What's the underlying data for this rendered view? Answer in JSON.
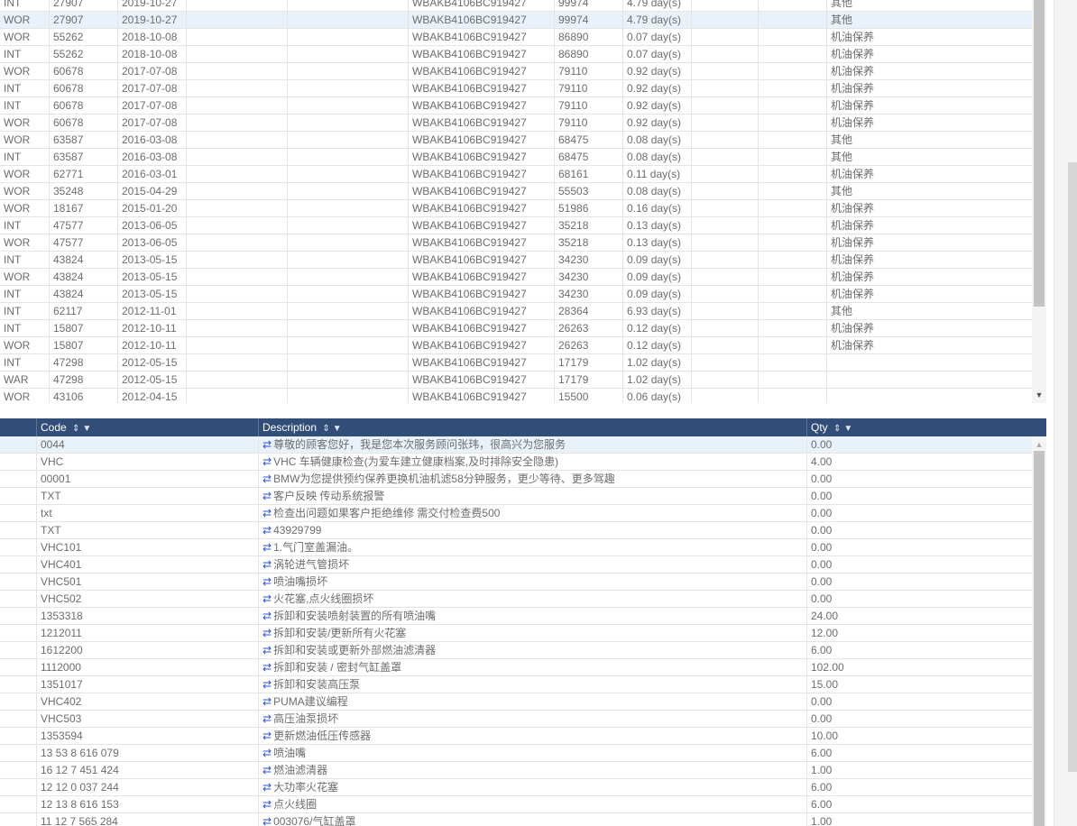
{
  "top_grid": {
    "rows": [
      [
        "INT",
        "27907",
        "2019-10-27",
        "",
        "",
        "WBAKB4106BC919427",
        "99974",
        "4.79 day(s)",
        "",
        "",
        "其他"
      ],
      [
        "WOR",
        "27907",
        "2019-10-27",
        "",
        "",
        "WBAKB4106BC919427",
        "99974",
        "4.79 day(s)",
        "",
        "",
        "其他"
      ],
      [
        "WOR",
        "55262",
        "2018-10-08",
        "",
        "",
        "WBAKB4106BC919427",
        "86890",
        "0.07 day(s)",
        "",
        "",
        "机油保养"
      ],
      [
        "INT",
        "55262",
        "2018-10-08",
        "",
        "",
        "WBAKB4106BC919427",
        "86890",
        "0.07 day(s)",
        "",
        "",
        "机油保养"
      ],
      [
        "WOR",
        "60678",
        "2017-07-08",
        "",
        "",
        "WBAKB4106BC919427",
        "79110",
        "0.92 day(s)",
        "",
        "",
        "机油保养"
      ],
      [
        "INT",
        "60678",
        "2017-07-08",
        "",
        "",
        "WBAKB4106BC919427",
        "79110",
        "0.92 day(s)",
        "",
        "",
        "机油保养"
      ],
      [
        "INT",
        "60678",
        "2017-07-08",
        "",
        "",
        "WBAKB4106BC919427",
        "79110",
        "0.92 day(s)",
        "",
        "",
        "机油保养"
      ],
      [
        "WOR",
        "60678",
        "2017-07-08",
        "",
        "",
        "WBAKB4106BC919427",
        "79110",
        "0.92 day(s)",
        "",
        "",
        "机油保养"
      ],
      [
        "WOR",
        "63587",
        "2016-03-08",
        "",
        "",
        "WBAKB4106BC919427",
        "68475",
        "0.08 day(s)",
        "",
        "",
        "其他"
      ],
      [
        "INT",
        "63587",
        "2016-03-08",
        "",
        "",
        "WBAKB4106BC919427",
        "68475",
        "0.08 day(s)",
        "",
        "",
        "其他"
      ],
      [
        "WOR",
        "62771",
        "2016-03-01",
        "",
        "",
        "WBAKB4106BC919427",
        "68161",
        "0.11 day(s)",
        "",
        "",
        "机油保养"
      ],
      [
        "WOR",
        "35248",
        "2015-04-29",
        "",
        "",
        "WBAKB4106BC919427",
        "55503",
        "0.08 day(s)",
        "",
        "",
        "其他"
      ],
      [
        "WOR",
        "18167",
        "2015-01-20",
        "",
        "",
        "WBAKB4106BC919427",
        "51986",
        "0.16 day(s)",
        "",
        "",
        "机油保养"
      ],
      [
        "INT",
        "47577",
        "2013-06-05",
        "",
        "",
        "WBAKB4106BC919427",
        "35218",
        "0.13 day(s)",
        "",
        "",
        "机油保养"
      ],
      [
        "WOR",
        "47577",
        "2013-06-05",
        "",
        "",
        "WBAKB4106BC919427",
        "35218",
        "0.13 day(s)",
        "",
        "",
        "机油保养"
      ],
      [
        "INT",
        "43824",
        "2013-05-15",
        "",
        "",
        "WBAKB4106BC919427",
        "34230",
        "0.09 day(s)",
        "",
        "",
        "机油保养"
      ],
      [
        "WOR",
        "43824",
        "2013-05-15",
        "",
        "",
        "WBAKB4106BC919427",
        "34230",
        "0.09 day(s)",
        "",
        "",
        "机油保养"
      ],
      [
        "INT",
        "43824",
        "2013-05-15",
        "",
        "",
        "WBAKB4106BC919427",
        "34230",
        "0.09 day(s)",
        "",
        "",
        "机油保养"
      ],
      [
        "INT",
        "62117",
        "2012-11-01",
        "",
        "",
        "WBAKB4106BC919427",
        "28364",
        "6.93 day(s)",
        "",
        "",
        "其他"
      ],
      [
        "INT",
        "15807",
        "2012-10-11",
        "",
        "",
        "WBAKB4106BC919427",
        "26263",
        "0.12 day(s)",
        "",
        "",
        "机油保养"
      ],
      [
        "WOR",
        "15807",
        "2012-10-11",
        "",
        "",
        "WBAKB4106BC919427",
        "26263",
        "0.12 day(s)",
        "",
        "",
        "机油保养"
      ],
      [
        "INT",
        "47298",
        "2012-05-15",
        "",
        "",
        "WBAKB4106BC919427",
        "17179",
        "1.02 day(s)",
        "",
        "",
        ""
      ],
      [
        "WAR",
        "47298",
        "2012-05-15",
        "",
        "",
        "WBAKB4106BC919427",
        "17179",
        "1.02 day(s)",
        "",
        "",
        ""
      ],
      [
        "WOR",
        "43106",
        "2012-04-15",
        "",
        "",
        "WBAKB4106BC919427",
        "15500",
        "0.06 day(s)",
        "",
        "",
        ""
      ]
    ]
  },
  "bottom_grid": {
    "headers": {
      "code": "Code",
      "description": "Description",
      "qty": "Qty"
    },
    "rows": [
      {
        "code": "0044",
        "desc": "尊敬的顾客您好，我是您本次服务顾问张玮，很高兴为您服务",
        "qty": "0.00"
      },
      {
        "code": "VHC",
        "desc": "VHC 车辆健康检查(为爱车建立健康档案,及时排除安全隐患)",
        "qty": "4.00"
      },
      {
        "code": "00001",
        "desc": "BMW为您提供预约保养更换机油机滤58分钟服务，更少等待、更多驾趣",
        "qty": "0.00"
      },
      {
        "code": "TXT",
        "desc": "客户反映 传动系统报警",
        "qty": "0.00"
      },
      {
        "code": "txt",
        "desc": "检查出问题如果客户拒绝维修 需交付检查费500",
        "qty": "0.00"
      },
      {
        "code": "TXT",
        "desc": "43929799",
        "qty": "0.00"
      },
      {
        "code": "VHC101",
        "desc": "1.气门室盖漏油。",
        "qty": "0.00"
      },
      {
        "code": "VHC401",
        "desc": "涡轮进气管损坏",
        "qty": "0.00"
      },
      {
        "code": "VHC501",
        "desc": "喷油嘴损坏",
        "qty": "0.00"
      },
      {
        "code": "VHC502",
        "desc": "火花塞,点火线圈损坏",
        "qty": "0.00"
      },
      {
        "code": "1353318",
        "desc": "拆卸和安装喷射装置的所有喷油嘴",
        "qty": "24.00"
      },
      {
        "code": "1212011",
        "desc": "拆卸和安装/更新所有火花塞",
        "qty": "12.00"
      },
      {
        "code": "1612200",
        "desc": "拆卸和安装或更新外部燃油滤清器",
        "qty": "6.00"
      },
      {
        "code": "1112000",
        "desc": "拆卸和安装 / 密封气缸盖罩",
        "qty": "102.00"
      },
      {
        "code": "1351017",
        "desc": "拆卸和安装高压泵",
        "qty": "15.00"
      },
      {
        "code": "VHC402",
        "desc": "PUMA建议编程",
        "qty": "0.00"
      },
      {
        "code": "VHC503",
        "desc": "高压油泵损坏",
        "qty": "0.00"
      },
      {
        "code": "1353594",
        "desc": "更新燃油低压传感器",
        "qty": "10.00"
      },
      {
        "code": "13 53 8 616 079",
        "desc": "喷油嘴",
        "qty": "6.00"
      },
      {
        "code": "16 12 7 451 424",
        "desc": "燃油滤清器",
        "qty": "1.00"
      },
      {
        "code": "12 12 0 037 244",
        "desc": "大功率火花塞",
        "qty": "6.00"
      },
      {
        "code": "12 13 8 616 153",
        "desc": "点火线圈",
        "qty": "6.00"
      },
      {
        "code": "11 12 7 565 284",
        "desc": "003076/气缸盖罩",
        "qty": "1.00"
      }
    ]
  },
  "icons": {
    "sort": "⇕",
    "filter": "▼",
    "swap": "⇄",
    "scroll_down": "▼",
    "scroll_up": "▲"
  },
  "colors": {
    "header_bg": "#324e78",
    "row_highlight": "#e9f1fb",
    "swap_icon": "#2f55c8"
  }
}
